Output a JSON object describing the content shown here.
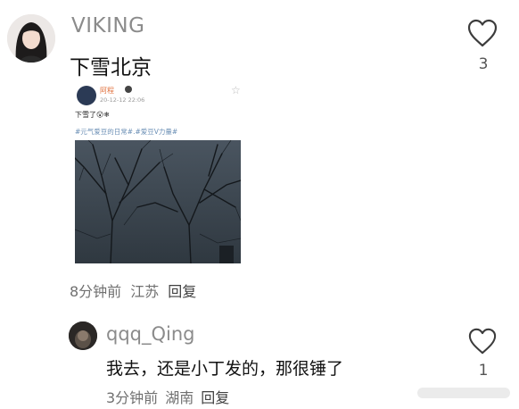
{
  "comments": [
    {
      "username": "VIKING",
      "text": "下雪北京",
      "likes": "3",
      "time": "8分钟前",
      "location": "江苏",
      "reply_label": "回复",
      "embedded_post": {
        "author": "阿程",
        "timestamp": "20-12-12 22:06",
        "text": "下雪了😮❄",
        "tags": "#元气爱豆的日常#.#爱豆V力量#"
      }
    },
    {
      "username": "qqq_Qing",
      "text": "我去，还是小丁发的，那很锤了",
      "likes": "1",
      "time": "3分钟前",
      "location": "湖南",
      "reply_label": "回复"
    }
  ],
  "icons": {
    "like": "heart-outline-icon",
    "star": "star-outline-icon"
  },
  "colors": {
    "username": "#8b8b8b",
    "embed_author": "#e0703c",
    "embed_tags": "#6b8fb5"
  }
}
